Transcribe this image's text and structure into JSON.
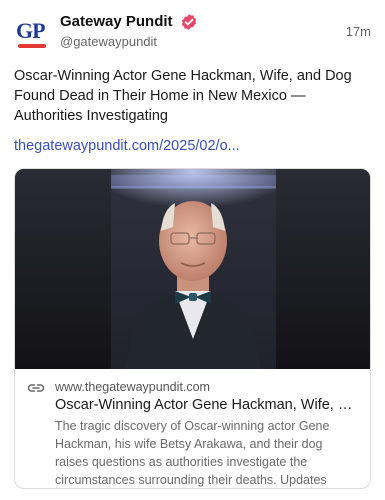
{
  "post": {
    "author_name": "Gateway Pundit",
    "author_handle": "@gatewaypundit",
    "avatar_text": "GP",
    "timestamp": "17m",
    "text": "Oscar-Winning Actor Gene Hackman, Wife, and Dog Found Dead in Their Home in New Mexico — Authorities Investigating",
    "link_text": "thegatewaypundit.com/2025/02/o..."
  },
  "card": {
    "domain": "www.thegatewaypundit.com",
    "title": "Oscar-Winning Actor Gene Hackman, Wife, an...",
    "description": "The tragic discovery of Oscar-winning actor Gene Hackman, his wife Betsy Arakawa, and their dog raises questions as authorities investigate the circumstances surrounding their deaths. Updates reveal no immediat..."
  },
  "icons": {
    "verified": "verified-badge-icon",
    "link": "link-icon"
  },
  "colors": {
    "verified_badge": "#e8456b",
    "link": "#3a4fb8",
    "avatar_text": "#1f3a93"
  }
}
